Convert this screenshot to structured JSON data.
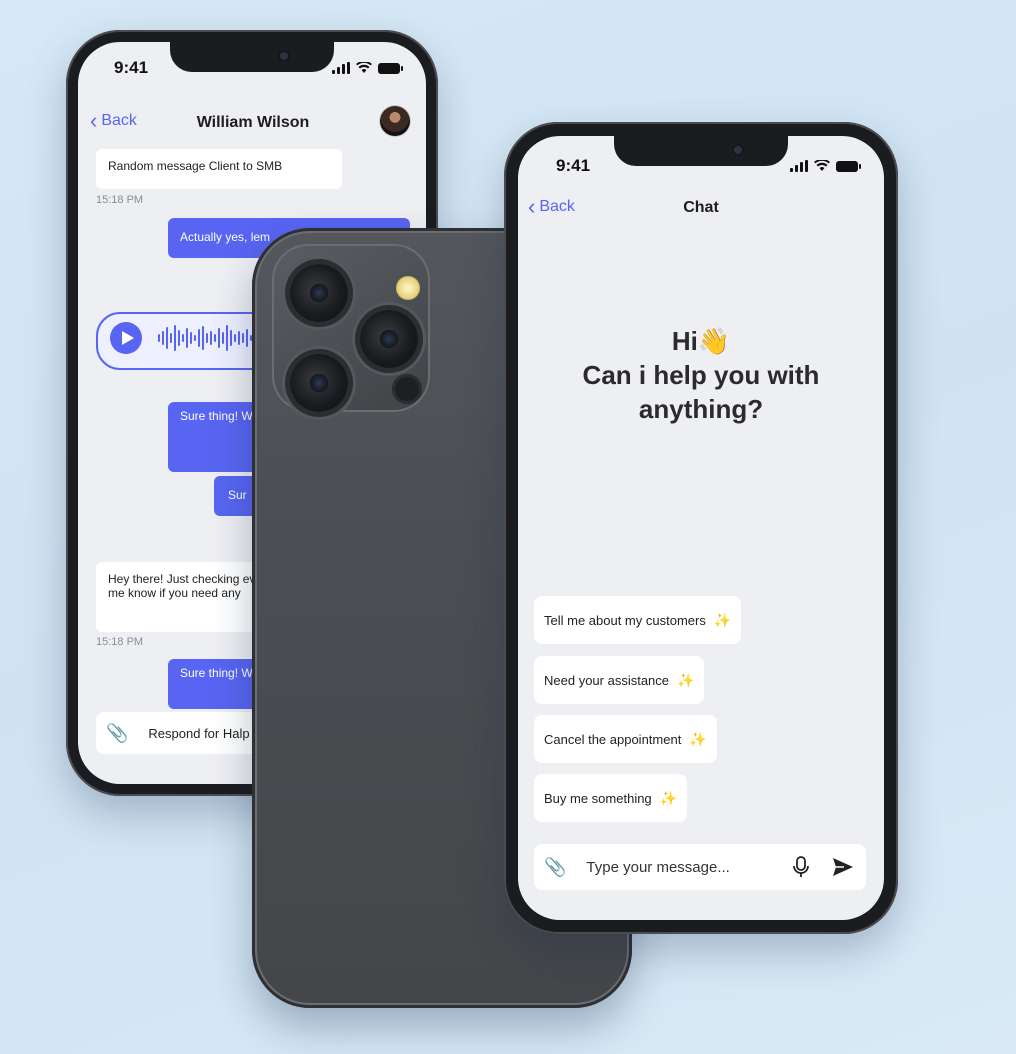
{
  "status": {
    "time": "9:41"
  },
  "left_chat": {
    "back_label": "Back",
    "contact_name": "William Wilson",
    "messages": [
      {
        "text": "Random message Client to SMB"
      },
      {
        "time": "15:18 PM"
      },
      {
        "text": "Actually yes, lem"
      },
      {
        "text": "Sure thing! W with? I'm her anything yo"
      },
      {
        "text": "Sur"
      },
      {
        "text": "Hey there! Just checking everything is going on yo me know if you need any"
      },
      {
        "time": "15:18 PM"
      },
      {
        "text": "Sure thing! W with? I'm her anything you"
      }
    ],
    "input_placeholder": "Respond for Halp"
  },
  "right_chat": {
    "back_label": "Back",
    "title": "Chat",
    "greeting": "Hi👋",
    "question_line1": "Can i help you with",
    "question_line2": "anything?",
    "suggestions": [
      "Tell me about my customers",
      "Need your assistance",
      "Cancel the appointment",
      "Buy me something"
    ],
    "spark_icon": "✨",
    "input_placeholder": "Type your message..."
  },
  "colors": {
    "accent": "#5865f2",
    "bubble_in": "#ffffff",
    "screen_bg": "#eeeff3"
  }
}
